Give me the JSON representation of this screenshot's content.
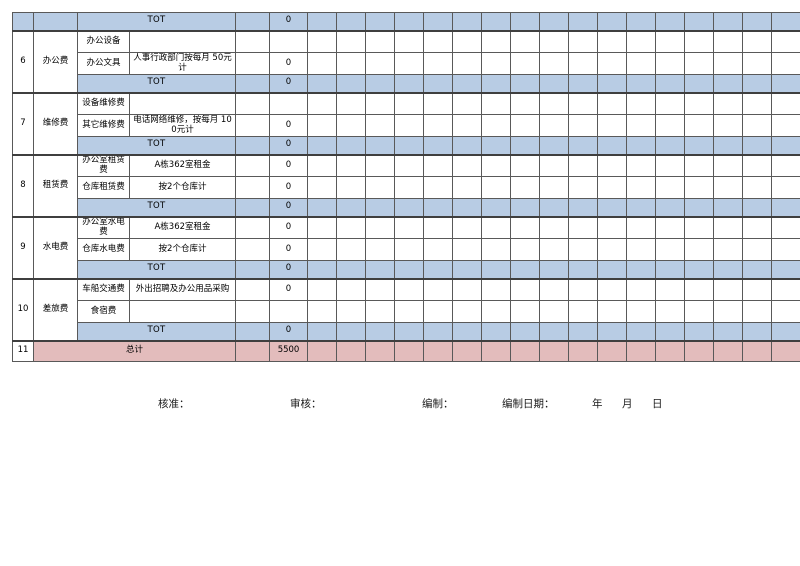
{
  "document": {
    "type": "budget-spreadsheet",
    "colors": {
      "total_row_fill": "#b8cce4",
      "grand_total_fill": "#e3bcbc",
      "grid_line": "#595959",
      "heavy_grid_line": "#3f3f3f",
      "text": "#000000"
    }
  },
  "labels": {
    "tot": "TOT",
    "grand_total": "总计"
  },
  "table": {
    "column_count": 23,
    "blank_columns_after_amount": 17,
    "partial_top_row": {
      "label": "TOT",
      "amount": "0"
    },
    "sections": [
      {
        "no": "6",
        "category": "办公费",
        "items": [
          {
            "sub": "办公设备",
            "desc": "",
            "amount": ""
          },
          {
            "sub": "办公文具",
            "desc": "人事行政部门按每月  50元计",
            "amount": "0"
          }
        ],
        "total_label": "TOT",
        "total_amount": "0"
      },
      {
        "no": "7",
        "category": "维修费",
        "items": [
          {
            "sub": "设备维修费",
            "desc": "",
            "amount": ""
          },
          {
            "sub": "其它维修费",
            "desc": "电话网络维修，按每月  100元计",
            "amount": "0"
          }
        ],
        "total_label": "TOT",
        "total_amount": "0"
      },
      {
        "no": "8",
        "category": "租赁费",
        "items": [
          {
            "sub": "办公室租赁费",
            "desc": "A栋362室租金",
            "amount": "0"
          },
          {
            "sub": "仓库租赁费",
            "desc": "按2个仓库计",
            "amount": "0"
          }
        ],
        "total_label": "TOT",
        "total_amount": "0"
      },
      {
        "no": "9",
        "category": "水电费",
        "items": [
          {
            "sub": "办公室水电费",
            "desc": "A栋362室租金",
            "amount": "0"
          },
          {
            "sub": "仓库水电费",
            "desc": "按2个仓库计",
            "amount": "0"
          }
        ],
        "total_label": "TOT",
        "total_amount": "0"
      },
      {
        "no": "10",
        "category": "差旅费",
        "items": [
          {
            "sub": "车船交通费",
            "desc": "外出招聘及办公用品采购",
            "amount": "0"
          },
          {
            "sub": "食宿费",
            "desc": "",
            "amount": ""
          }
        ],
        "total_label": "TOT",
        "total_amount": "0"
      }
    ],
    "grand_total": {
      "no": "11",
      "label": "总计",
      "amount": "5500"
    }
  },
  "footer": {
    "approve": "核准：",
    "review": "审核：",
    "prepare": "编制：",
    "prepare_date": "编制日期：",
    "year": "年",
    "month": "月",
    "day": "日"
  }
}
